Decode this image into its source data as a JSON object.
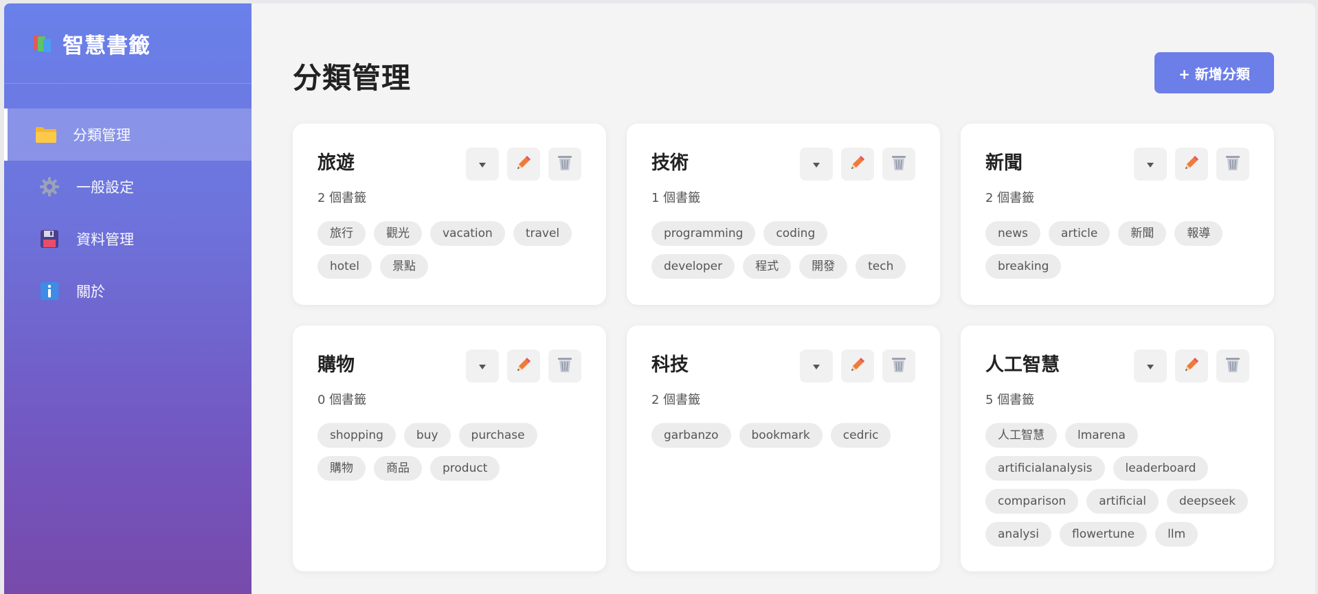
{
  "app": {
    "title": "智慧書籤"
  },
  "sidebar": {
    "items": [
      {
        "label": "分類管理",
        "icon": "folder-icon"
      },
      {
        "label": "一般設定",
        "icon": "gear-icon"
      },
      {
        "label": "資料管理",
        "icon": "floppy-disk-icon"
      },
      {
        "label": "關於",
        "icon": "info-icon"
      }
    ]
  },
  "main": {
    "title": "分類管理",
    "add_label": "+ 新增分類"
  },
  "categories": [
    {
      "name": "旅遊",
      "count": "2 個書籤",
      "tags": [
        "旅行",
        "觀光",
        "vacation",
        "travel",
        "hotel",
        "景點"
      ]
    },
    {
      "name": "技術",
      "count": "1 個書籤",
      "tags": [
        "programming",
        "coding",
        "developer",
        "程式",
        "開發",
        "tech"
      ]
    },
    {
      "name": "新聞",
      "count": "2 個書籤",
      "tags": [
        "news",
        "article",
        "新聞",
        "報導",
        "breaking"
      ]
    },
    {
      "name": "購物",
      "count": "0 個書籤",
      "tags": [
        "shopping",
        "buy",
        "purchase",
        "購物",
        "商品",
        "product"
      ]
    },
    {
      "name": "科技",
      "count": "2 個書籤",
      "tags": [
        "garbanzo",
        "bookmark",
        "cedric"
      ]
    },
    {
      "name": "人工智慧",
      "count": "5 個書籤",
      "tags": [
        "人工智慧",
        "lmarena",
        "artificialanalysis",
        "leaderboard",
        "comparison",
        "artificial",
        "deepseek",
        "analysi",
        "flowertune",
        "llm"
      ]
    }
  ],
  "colors": {
    "accent": "#6c7ee8",
    "sidebar_top": "#6a80ea",
    "sidebar_bottom": "#774aab"
  }
}
